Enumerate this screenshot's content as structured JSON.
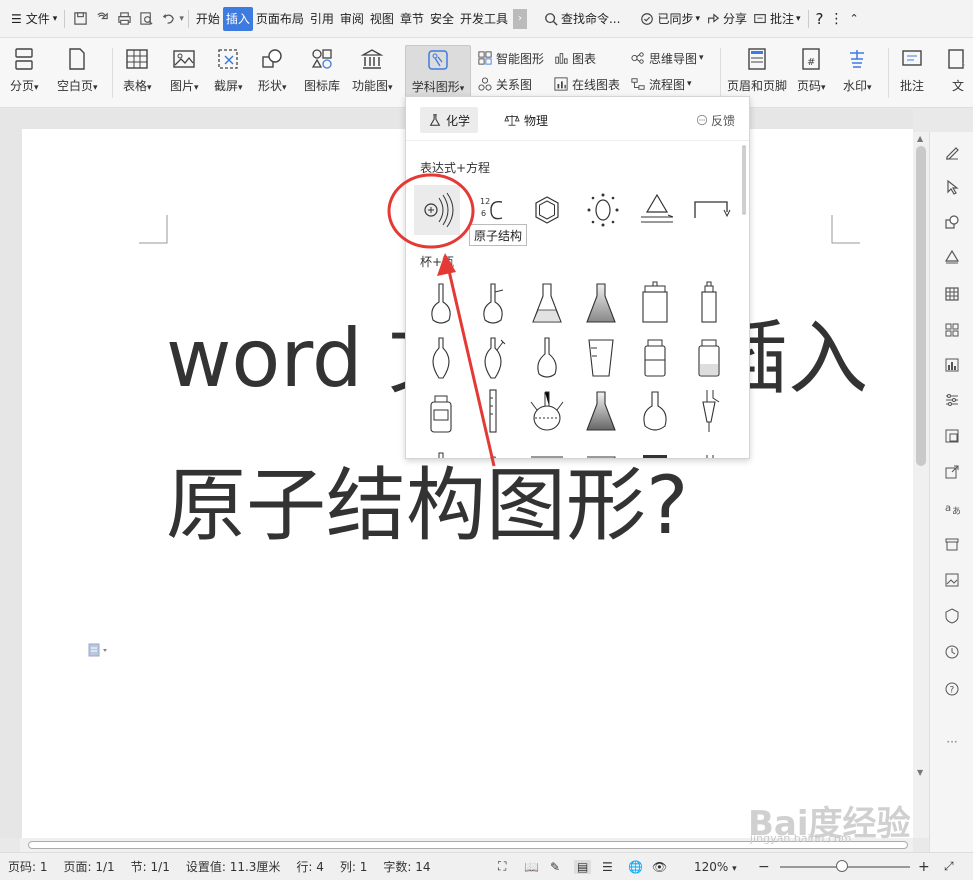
{
  "menubar": {
    "file": "文件",
    "tabs": [
      "开始",
      "插入",
      "页面布局",
      "引用",
      "审阅",
      "视图",
      "章节",
      "安全",
      "开发工具"
    ],
    "active_tab": "插入",
    "search": "查找命令...",
    "synced": "已同步",
    "share": "分享",
    "comment": "批注",
    "help": "?"
  },
  "ribbon": {
    "page_break": "分页",
    "blank_page": "空白页",
    "table": "表格",
    "picture": "图片",
    "screenshot": "截屏",
    "shape": "形状",
    "icon_lib": "图标库",
    "func_chart": "功能图",
    "subject_chart": "学科图形",
    "smart_shape": "智能图形",
    "chart": "图表",
    "mindmap": "思维导图",
    "relation": "关系图",
    "online_chart": "在线图表",
    "flowchart": "流程图",
    "header_footer": "页眉和页脚",
    "page_number": "页码",
    "watermark": "水印",
    "comment": "批注",
    "text": "文"
  },
  "dropdown": {
    "tab_chemistry": "化学",
    "tab_physics": "物理",
    "feedback": "反馈",
    "section_formula": "表达式+方程",
    "section_cups": "杯+瓶",
    "tooltip": "原子结构",
    "isotope_mass": "12",
    "isotope_number": "6"
  },
  "document": {
    "line1": "word 文档如何插入",
    "line2": "原子结构图形?"
  },
  "statusbar": {
    "page": "页码: 1",
    "pages": "页面: 1/1",
    "section": "节: 1/1",
    "setting": "设置值: 11.3厘米",
    "row": "行: 4",
    "col": "列: 1",
    "words": "字数: 14",
    "zoom": "120%"
  },
  "watermark": {
    "brand": "Bai度经验",
    "url": "jingyan.baidu.com"
  },
  "colors": {
    "accent": "#3e7be0",
    "annotation": "#e53935"
  }
}
